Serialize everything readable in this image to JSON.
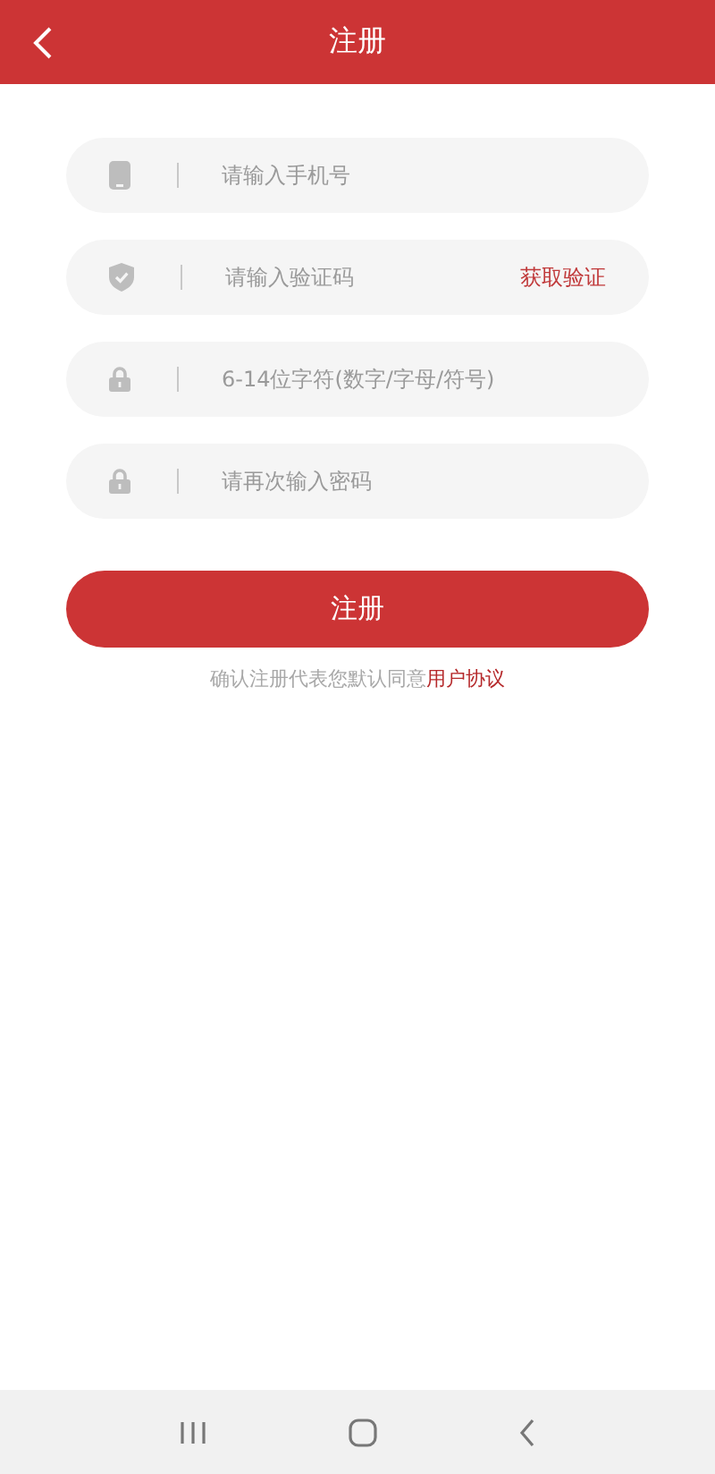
{
  "header": {
    "title": "注册"
  },
  "fields": [
    {
      "kind": "phone",
      "placeholder": "请输入手机号"
    },
    {
      "kind": "code",
      "placeholder": "请输入验证码",
      "action": "获取验证"
    },
    {
      "kind": "password",
      "placeholder": "6-14位字符(数字/字母/符号)"
    },
    {
      "kind": "password",
      "placeholder": "请再次输入密码"
    }
  ],
  "submit": "注册",
  "agreement": {
    "text": "确认注册代表您默认同意",
    "link": "用户协议"
  }
}
